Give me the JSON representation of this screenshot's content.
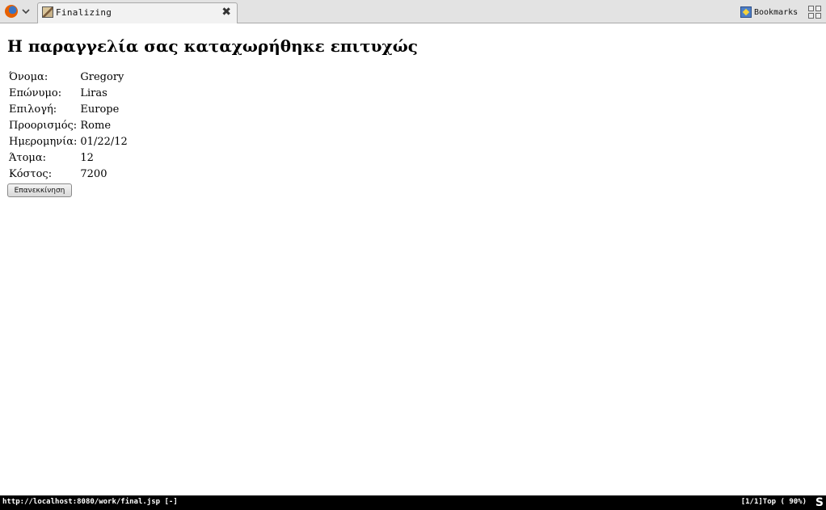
{
  "browser": {
    "tab": {
      "title": "Finalizing",
      "close_glyph": "✖"
    },
    "bookmarks_label": "Bookmarks"
  },
  "page": {
    "heading": "Η παραγγελία σας καταχωρήθηκε επιτυχώς",
    "rows": [
      {
        "label": "Όνομα:",
        "value": "Gregory"
      },
      {
        "label": "Επώνυμο:",
        "value": "Liras"
      },
      {
        "label": "Επιλογή:",
        "value": "Europe"
      },
      {
        "label": "Προορισμός:",
        "value": "Rome"
      },
      {
        "label": "Ημερομηνία:",
        "value": "01/22/12"
      },
      {
        "label": "Άτομα:",
        "value": "12"
      },
      {
        "label": "Κόστος:",
        "value": "7200"
      }
    ],
    "restart_button": "Επανεκκίνηση"
  },
  "statusbar": {
    "url": "http://localhost:8080/work/final.jsp [-]",
    "position": "[1/1]Top ( 90%)",
    "s_glyph": "S"
  },
  "icons": {
    "app_menu": "firefox-icon",
    "app_menu_dropdown": "chevron-down-icon",
    "favicon": "page-favicon-icon",
    "close": "close-icon",
    "bookmarks": "bookmarks-star-icon",
    "tab_groups": "tab-groups-icon"
  }
}
